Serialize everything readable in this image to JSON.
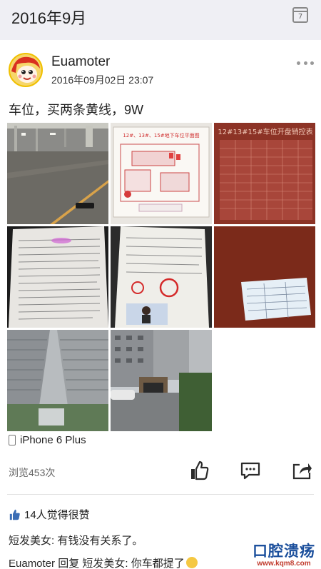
{
  "header": {
    "month": "2016年9月",
    "calendar_day": "7"
  },
  "post": {
    "username": "Euamoter",
    "timestamp": "2016年09月02日 23:07",
    "text": "车位，买两条黄线，9W",
    "photo_captions": {
      "floor_plan_title": "12#、13#、15#地下车位平面图",
      "sales_table_title": "12#13#15#车位开盘销控表"
    },
    "device": "iPhone 6 Plus",
    "views": "浏览453次",
    "likes": "14人觉得很赞"
  },
  "comments": [
    {
      "author": "短发美女",
      "separator": ": ",
      "text": "有钱没有关系了。"
    },
    {
      "author": "Euamoter",
      "reply_word": " 回复 ",
      "reply_to": "短发美女",
      "separator": ": ",
      "text": "你车都提了"
    }
  ],
  "watermark": {
    "text": "口腔溃疡",
    "url": "www.kqm8.com"
  },
  "icons": {
    "calendar": "calendar-icon",
    "more": "more-icon",
    "like": "thumbs-up-icon",
    "comment": "comment-icon",
    "share": "share-icon",
    "device": "phone-icon"
  }
}
